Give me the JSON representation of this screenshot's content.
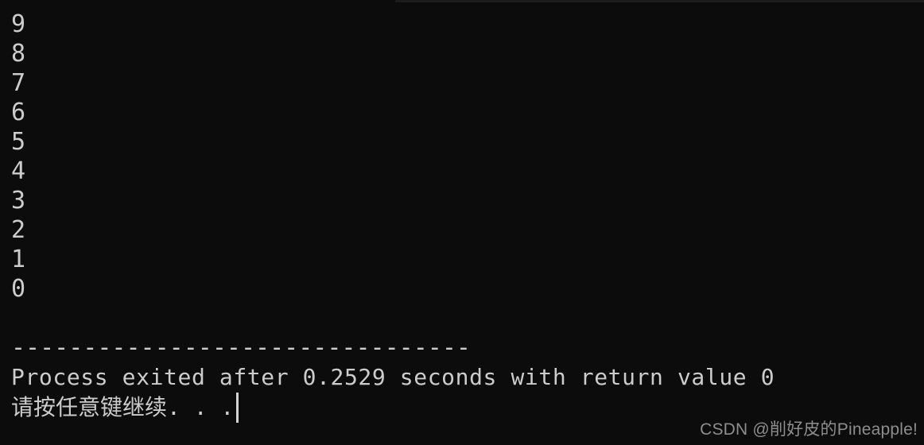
{
  "window": {
    "kind": "console-terminal",
    "background_color": "#0c0c0c",
    "text_color": "#cccccc",
    "top_strip_color": "#1c1c1c"
  },
  "console": {
    "countdown_lines": [
      "9",
      "8",
      "7",
      "6",
      "5",
      "4",
      "3",
      "2",
      "1",
      "0"
    ],
    "blank_line": " ",
    "separator": "--------------------------------",
    "exit_message": "Process exited after 0.2529 seconds with return value 0",
    "prompt_message": "请按任意键继续. . .",
    "cursor": "|",
    "exit_details": {
      "seconds": "0.2529",
      "return_value": "0"
    }
  },
  "watermark": {
    "text": "CSDN @削好皮的Pineapple!",
    "color": "#8d8d8d"
  }
}
